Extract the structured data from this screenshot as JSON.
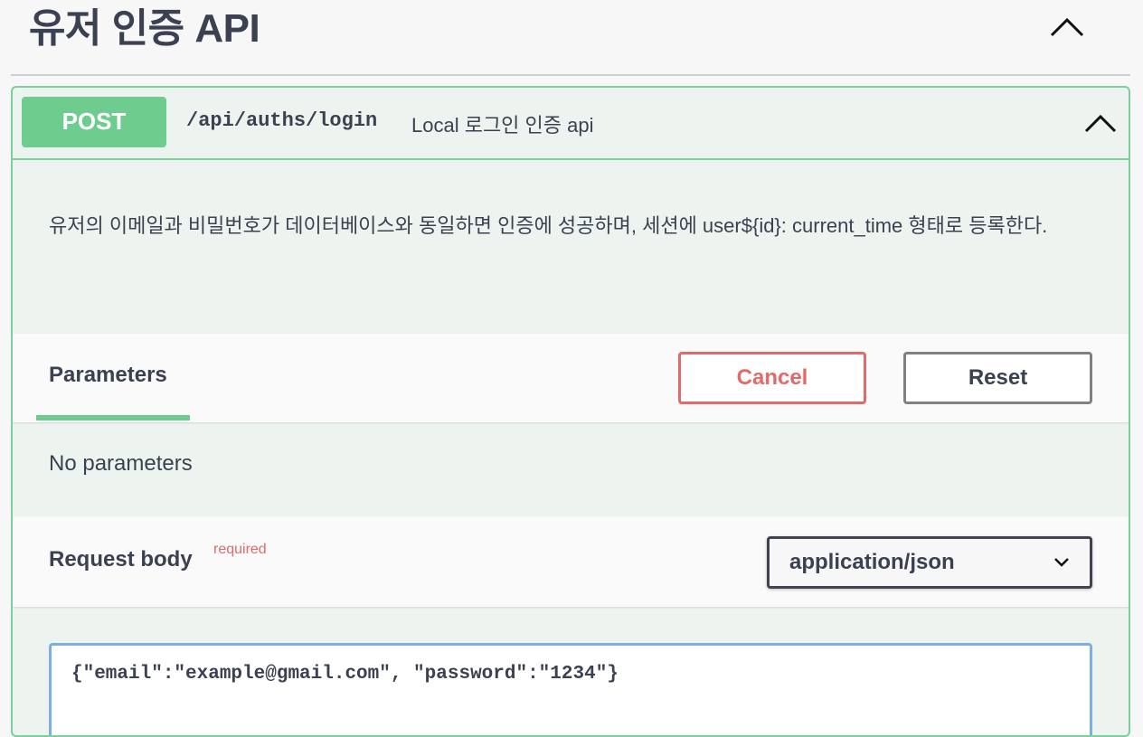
{
  "tag": {
    "title": "유저 인증 API",
    "chevron_icon": "chevron-up-icon"
  },
  "operation": {
    "method": "POST",
    "path": "/api/auths/login",
    "summary": "Local 로그인 인증 api",
    "chevron_icon": "chevron-up-icon",
    "description": "유저의 이메일과 비밀번호가 데이터베이스와 동일하면 인증에 성공하며, 세션에 user${id}: current_time 형태로 등록한다.",
    "colors": {
      "method_bg": "#6fcc8f",
      "border": "#7dcf9c",
      "background": "#edf4ef",
      "cancel": "#e26a6a"
    }
  },
  "parameters": {
    "tab_label": "Parameters",
    "cancel_label": "Cancel",
    "reset_label": "Reset",
    "empty_text": "No parameters"
  },
  "request_body": {
    "title": "Request body",
    "required_label": "required",
    "content_type": "application/json",
    "select_icon": "chevron-down-icon",
    "value": "{\"email\":\"example@gmail.com\", \"password\":\"1234\"}"
  }
}
